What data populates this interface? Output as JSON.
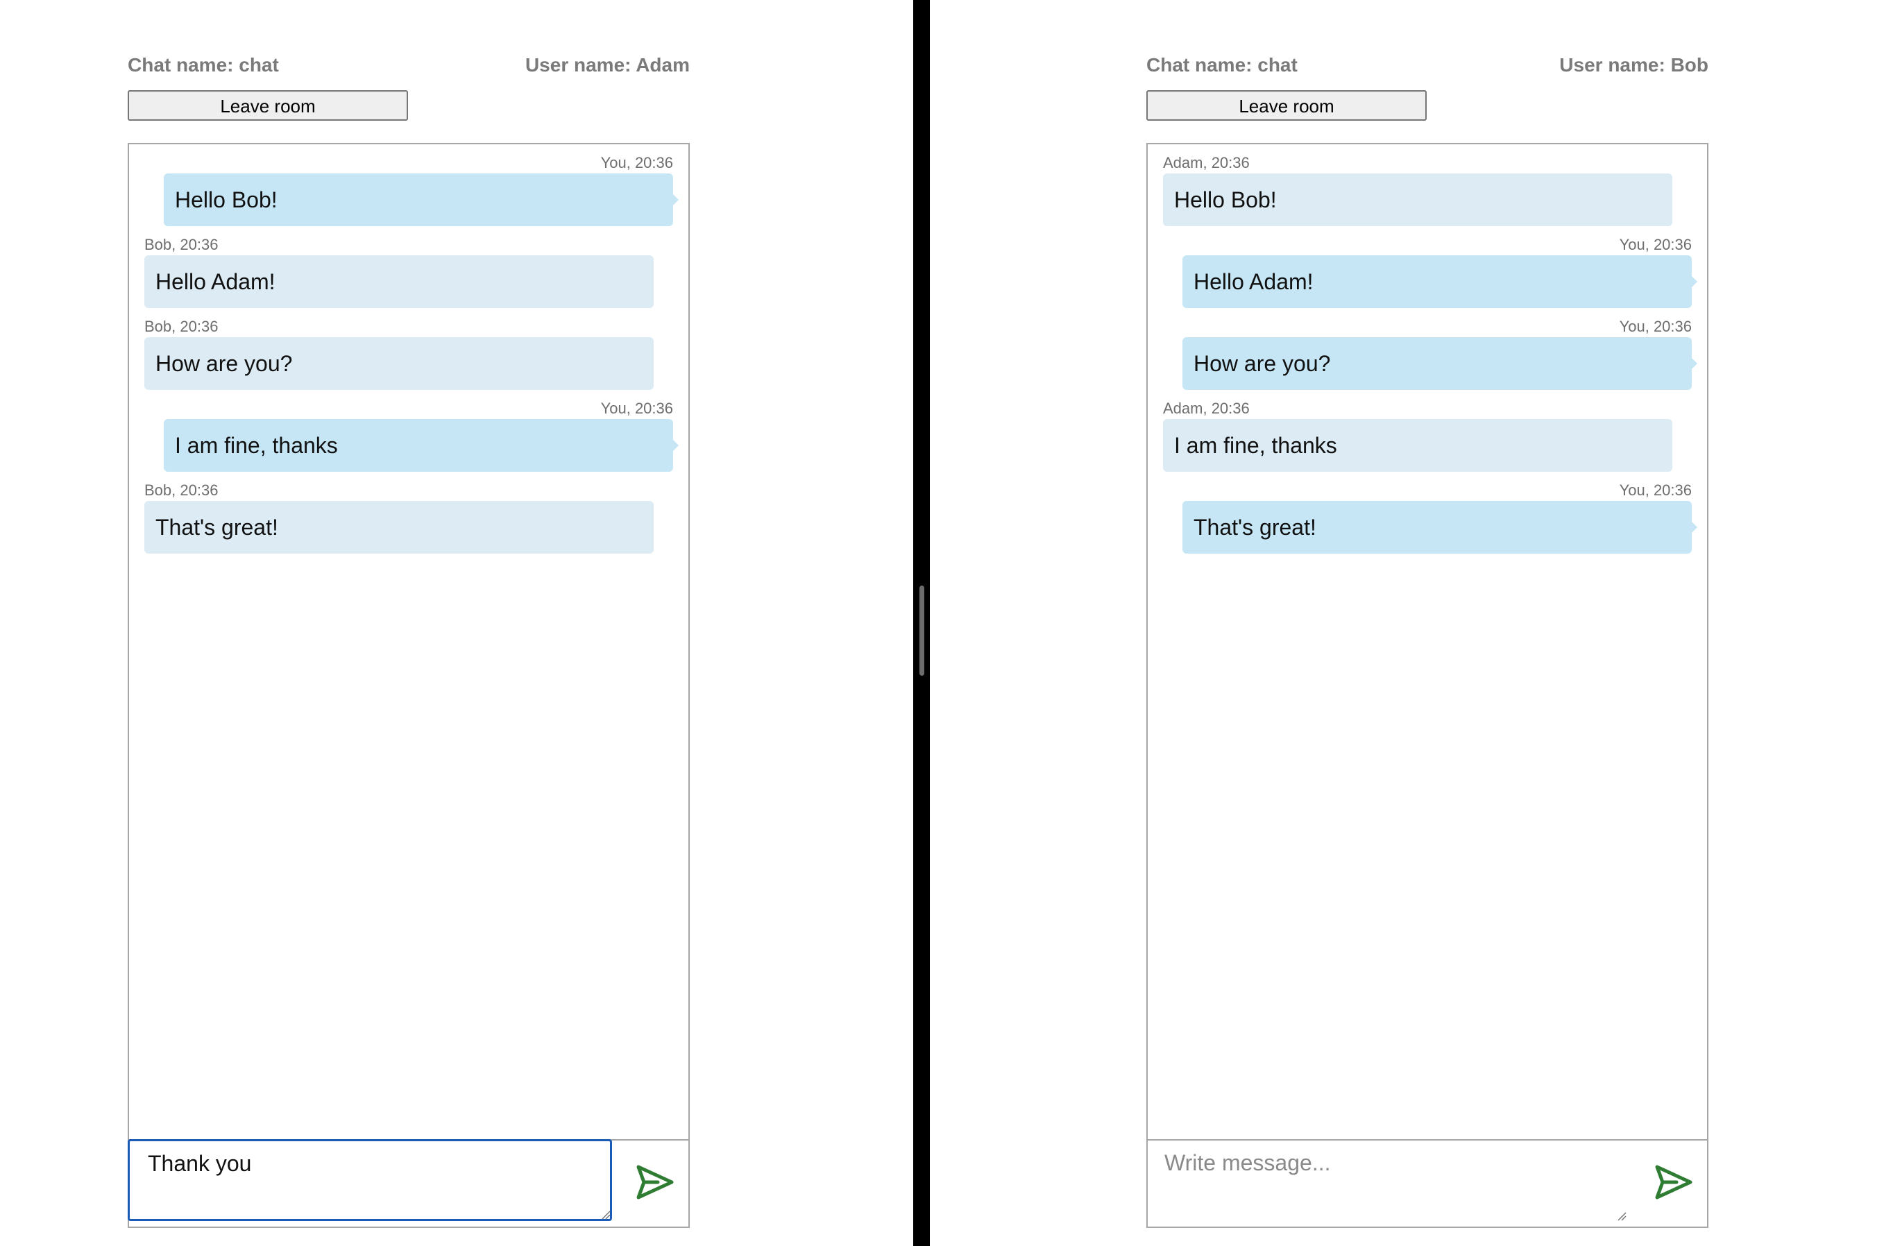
{
  "colors": {
    "accent_send": "#2e7d32",
    "bubble_mine": "#c6e6f5",
    "bubble_other": "#dcebf4",
    "focus_border": "#1a5bb8",
    "divider": "#000000"
  },
  "left": {
    "chat_name": "Chat name: chat",
    "user_name": "User name: Adam",
    "leave_label": "Leave room",
    "messages": [
      {
        "side": "mine",
        "meta": "You, 20:36",
        "text": "Hello Bob!"
      },
      {
        "side": "other",
        "meta": "Bob, 20:36",
        "text": "Hello Adam!"
      },
      {
        "side": "other",
        "meta": "Bob, 20:36",
        "text": "How are you?"
      },
      {
        "side": "mine",
        "meta": "You, 20:36",
        "text": "I am fine, thanks"
      },
      {
        "side": "other",
        "meta": "Bob, 20:36",
        "text": "That's great!"
      }
    ],
    "input_value": "Thank you",
    "input_placeholder": "Write message...",
    "send_icon": "send-icon"
  },
  "right": {
    "chat_name": "Chat name: chat",
    "user_name": "User name: Bob",
    "leave_label": "Leave room",
    "messages": [
      {
        "side": "other",
        "meta": "Adam, 20:36",
        "text": "Hello Bob!"
      },
      {
        "side": "mine",
        "meta": "You, 20:36",
        "text": "Hello Adam!"
      },
      {
        "side": "mine",
        "meta": "You, 20:36",
        "text": "How are you?"
      },
      {
        "side": "other",
        "meta": "Adam, 20:36",
        "text": "I am fine, thanks"
      },
      {
        "side": "mine",
        "meta": "You, 20:36",
        "text": "That's great!"
      }
    ],
    "input_value": "",
    "input_placeholder": "Write message...",
    "send_icon": "send-icon"
  }
}
